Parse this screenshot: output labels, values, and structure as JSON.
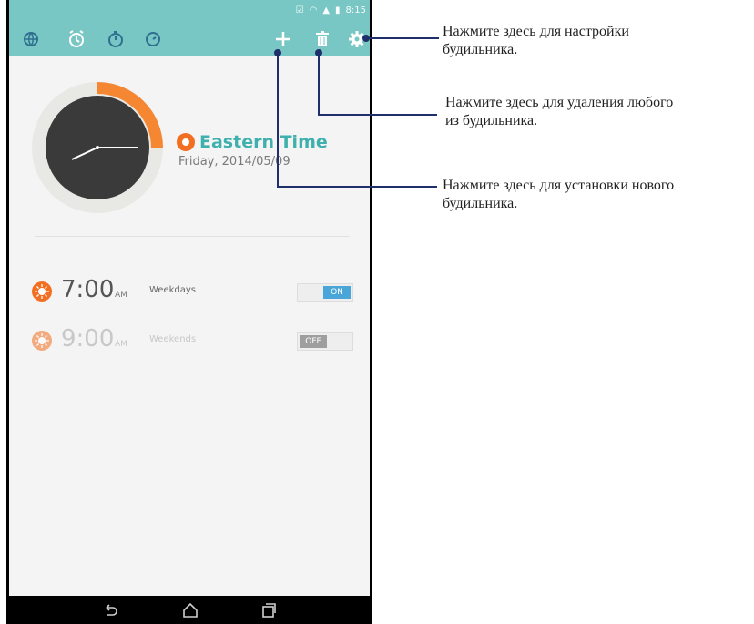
{
  "status_bar": {
    "time": "8:15"
  },
  "toolbar": {
    "icons": [
      "globe-icon",
      "alarm-clock-icon",
      "stopwatch-icon",
      "timer-icon",
      "plus-icon",
      "trash-icon",
      "gear-icon"
    ]
  },
  "world_clock": {
    "timezone": "Eastern Time",
    "date": "Friday, 2014/05/09"
  },
  "alarms": [
    {
      "time": "7:00",
      "ampm": "AM",
      "days": "Weekdays",
      "toggle": "ON"
    },
    {
      "time": "9:00",
      "ampm": "AM",
      "days": "Weekends",
      "toggle": "OFF"
    }
  ],
  "callouts": {
    "settings": [
      "Нажмите здесь для настройки",
      "будильника."
    ],
    "delete": [
      "Нажмите здесь для удаления любого",
      "из будильника."
    ],
    "add": [
      "Нажмите здесь для установки нового",
      "будильника."
    ]
  },
  "colors": {
    "toolbar": "#78c7c4",
    "accent_orange": "#f26f21",
    "timezone_teal": "#3fb0ad",
    "toggle_on": "#4aa6d9",
    "callout_line": "#1e2f6b"
  }
}
